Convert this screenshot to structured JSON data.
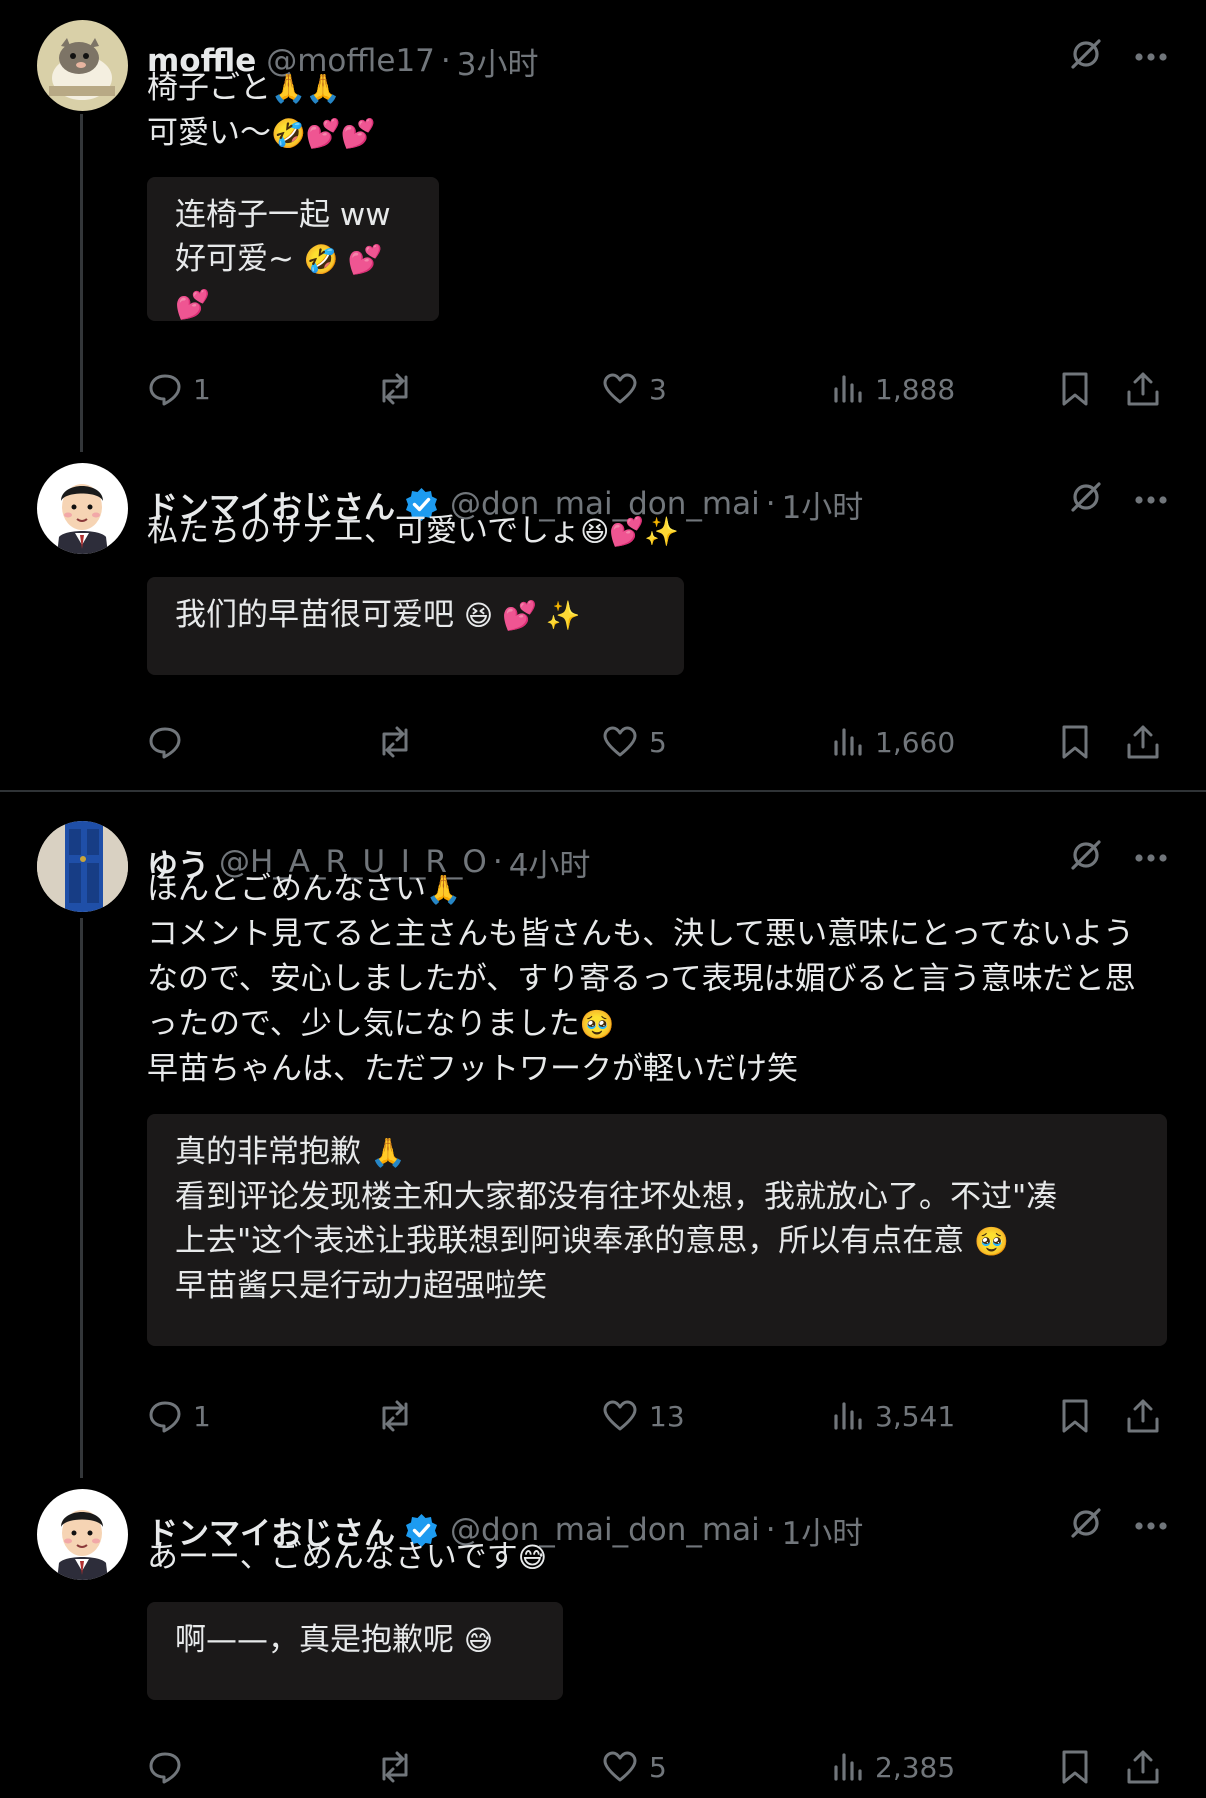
{
  "colors": {
    "background": "#000000",
    "text": "#e7e9ea",
    "muted": "#71767b",
    "quote_bg": "#1b1919",
    "verified": "#1d9bf0",
    "heart": "#f91880"
  },
  "posts": [
    {
      "display_name": "moffle",
      "handle": "@moffle17",
      "separator": "·",
      "time": "3小时",
      "verified": false,
      "lines": [
        {
          "text": "椅子ごと",
          "emoji": "🙏🙏"
        },
        {
          "text": "可愛い〜",
          "emoji": "🤣💕💕"
        }
      ],
      "translation": [
        {
          "text": "连椅子一起 ww",
          "emoji": ""
        },
        {
          "text": "好可爱~",
          "emoji": "🤣 💕 💕"
        }
      ],
      "stats": {
        "replies": "1",
        "reposts": "",
        "likes": "3",
        "views": "1,888"
      }
    },
    {
      "display_name": "ドンマイおじさん",
      "handle": "@don_mai_don_mai",
      "separator": "·",
      "time": "1小时",
      "verified": true,
      "lines": [
        {
          "text": "私たちのサナエ、可愛いでしょ",
          "emoji": "😆💕✨"
        }
      ],
      "translation": [
        {
          "text": "我们的早苗很可爱吧",
          "emoji": "😆 💕 ✨"
        }
      ],
      "stats": {
        "replies": "",
        "reposts": "",
        "likes": "5",
        "views": "1,660"
      }
    },
    {
      "display_name": "ゆう",
      "handle": "@H_A_R_U_I_R_O",
      "separator": "·",
      "time": "4小时",
      "verified": false,
      "lines": [
        {
          "text": "ほんとごめんなさい",
          "emoji": "🙏"
        },
        {
          "text": "コメント見てると主さんも皆さんも、決して悪い意味にとってないよう",
          "emoji": ""
        },
        {
          "text": "なので、安心しましたが、すり寄るって表現は媚びると言う意味だと思",
          "emoji": ""
        },
        {
          "text": "ったので、少し気になりました",
          "emoji": "🥹"
        },
        {
          "text": "早苗ちゃんは、ただフットワークが軽いだけ笑",
          "emoji": ""
        }
      ],
      "translation": [
        {
          "text": "真的非常抱歉",
          "emoji": "🙏"
        },
        {
          "text": "看到评论发现楼主和大家都没有往坏处想，我就放心了。不过\"凑",
          "emoji": ""
        },
        {
          "text": "上去\"这个表述让我联想到阿谀奉承的意思，所以有点在意",
          "emoji": "🥹"
        },
        {
          "text": "早苗酱只是行动力超强啦笑",
          "emoji": ""
        }
      ],
      "stats": {
        "replies": "1",
        "reposts": "",
        "likes": "13",
        "views": "3,541"
      }
    },
    {
      "display_name": "ドンマイおじさん",
      "handle": "@don_mai_don_mai",
      "separator": "·",
      "time": "1小时",
      "verified": true,
      "lines": [
        {
          "text": "あーー、ごめんなさいです",
          "emoji": "😅"
        }
      ],
      "translation": [
        {
          "text": "啊——，真是抱歉呢",
          "emoji": "😅"
        }
      ],
      "stats": {
        "replies": "",
        "reposts": "",
        "likes": "5",
        "views": "2,385"
      }
    }
  ]
}
